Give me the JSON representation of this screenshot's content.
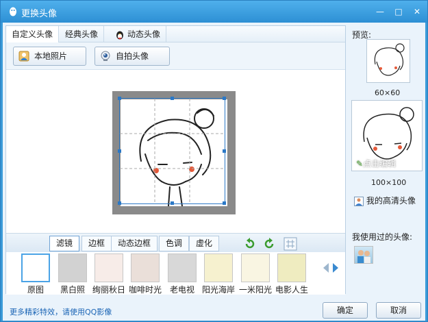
{
  "window": {
    "title": "更换头像"
  },
  "tabs": [
    {
      "label": "自定义头像"
    },
    {
      "label": "经典头像"
    },
    {
      "label": "动态头像"
    }
  ],
  "toolbar": {
    "local_photo": "本地照片",
    "selfie": "自拍头像"
  },
  "filter_tabs": [
    "滤镜",
    "边框",
    "动态边框",
    "色调",
    "虚化"
  ],
  "filters": [
    "原图",
    "黑白照",
    "绚丽秋日",
    "咖啡时光",
    "老电视",
    "阳光海岸",
    "一米阳光",
    "电影人生"
  ],
  "preview": {
    "label": "预览:",
    "small_size": "60×60",
    "large_size": "100×100",
    "edit": "点击编辑",
    "hd_avatar": "我的高清头像",
    "used_label": "我使用过的头像:"
  },
  "footer": {
    "promo": "更多精彩特效，请使用QQ影像",
    "ok": "确定",
    "cancel": "取消"
  },
  "colors": {
    "titlebar": "#3a9ad8",
    "accent": "#2b78c6",
    "link": "#1a64b5"
  }
}
